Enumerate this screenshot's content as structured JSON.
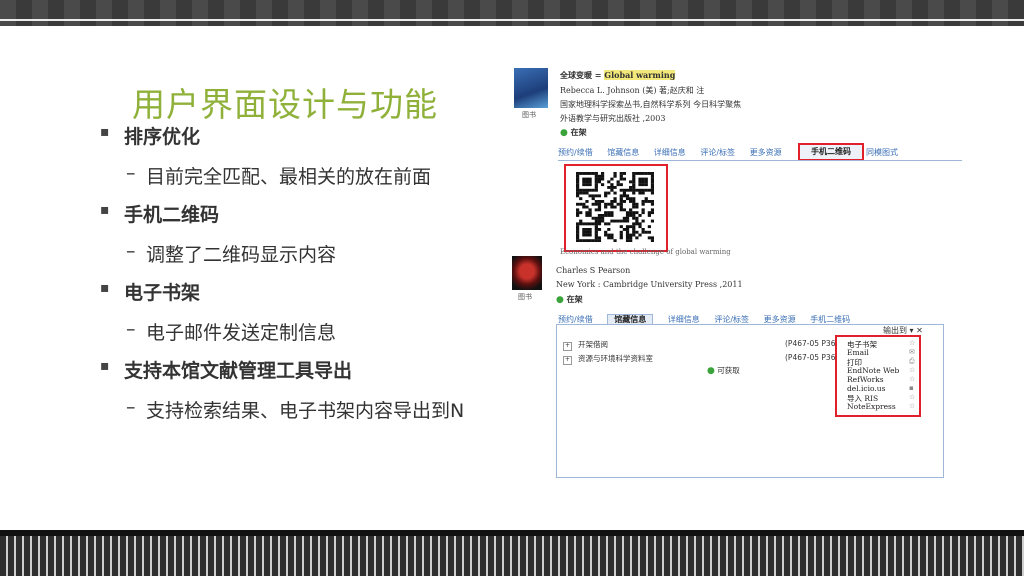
{
  "slide": {
    "title": "用户界面设计与功能",
    "bullets": [
      {
        "head": "排序优化",
        "sub": "目前完全匹配、最相关的放在前面"
      },
      {
        "head": "手机二维码",
        "sub": "调整了二维码显示内容"
      },
      {
        "head": "电子书架",
        "sub": "电子邮件发送定制信息"
      },
      {
        "head": "支持本馆文献管理工具导出",
        "sub": "支持检索结果、电子书架内容导出到N"
      }
    ],
    "bullet_marker": "▪",
    "dash": "–"
  },
  "record1": {
    "title_prefix": "全球变暖 = ",
    "title_highlight": "Global warming",
    "author": "Rebecca L. Johnson (美) 著;赵庆和 注",
    "series": "国家地理科学探索丛书,自然科学系列 今日科学聚焦",
    "publisher": "外语教学与研究出版社 ,2003",
    "status": "在架",
    "cover_label": "图书",
    "tabs": [
      "预约/续借",
      "馆藏信息",
      "详细信息",
      "评论/标签",
      "更多资源",
      "手机二维码",
      "同模图式"
    ],
    "active_tab": "手机二维码"
  },
  "record2": {
    "title": "Economics and the challenge of global warming",
    "author": "Charles S Pearson",
    "publisher": "New York : Cambridge University Press ,2011",
    "status": "在架",
    "cover_label": "图书",
    "tabs": [
      "预约/续借",
      "馆藏信息",
      "详细信息",
      "评论/标签",
      "更多资源",
      "手机二维码"
    ],
    "active_tab": "馆藏信息",
    "holdings": [
      {
        "location": "开架借阅",
        "call_no": "(P467-05 P36 )"
      },
      {
        "location": "资源与环境科学资料室",
        "call_no": "(P467-05 P36 )"
      }
    ],
    "availability": "可获取",
    "export_header": "输出到",
    "export_options": [
      "电子书架",
      "Email",
      "打印",
      "EndNote Web",
      "RefWorks",
      "del.icio.us",
      "导入 RIS",
      "NoteExpress"
    ]
  },
  "colors": {
    "title": "#8fb13a",
    "highlight_red": "#e0202a",
    "link_blue": "#3a6fb5"
  }
}
